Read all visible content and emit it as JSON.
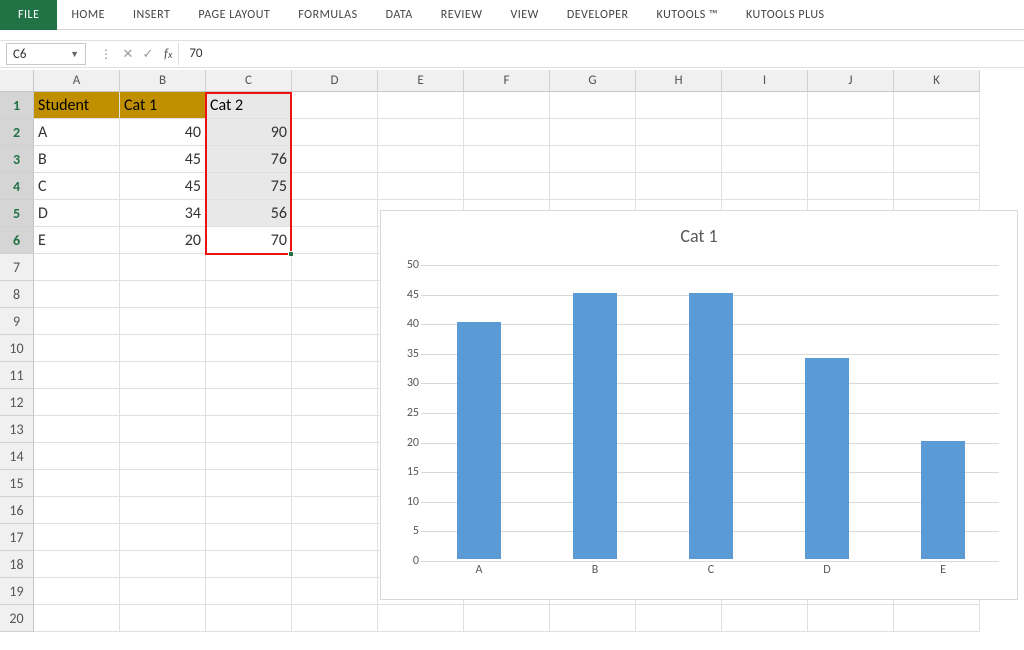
{
  "ribbon": {
    "file": "FILE",
    "tabs": [
      "HOME",
      "INSERT",
      "PAGE LAYOUT",
      "FORMULAS",
      "DATA",
      "REVIEW",
      "VIEW",
      "DEVELOPER",
      "KUTOOLS ™",
      "KUTOOLS PLUS"
    ]
  },
  "namebox": "C6",
  "formula_value": "70",
  "columns": [
    "A",
    "B",
    "C",
    "D",
    "E",
    "F",
    "G",
    "H",
    "I",
    "J",
    "K"
  ],
  "row_count": 20,
  "selected_rows": [
    1,
    2,
    3,
    4,
    5,
    6
  ],
  "headers": {
    "a": "Student",
    "b": "Cat 1",
    "c": "Cat 2"
  },
  "rows": [
    {
      "a": "A",
      "b": 40,
      "c": 90
    },
    {
      "a": "B",
      "b": 45,
      "c": 76
    },
    {
      "a": "C",
      "b": 45,
      "c": 75
    },
    {
      "a": "D",
      "b": 34,
      "c": 56
    },
    {
      "a": "E",
      "b": 20,
      "c": 70
    }
  ],
  "chart_data": {
    "type": "bar",
    "title": "Cat 1",
    "categories": [
      "A",
      "B",
      "C",
      "D",
      "E"
    ],
    "values": [
      40,
      45,
      45,
      34,
      20
    ],
    "ylim": [
      0,
      50
    ],
    "ytick": 5,
    "xlabel": "",
    "ylabel": ""
  }
}
